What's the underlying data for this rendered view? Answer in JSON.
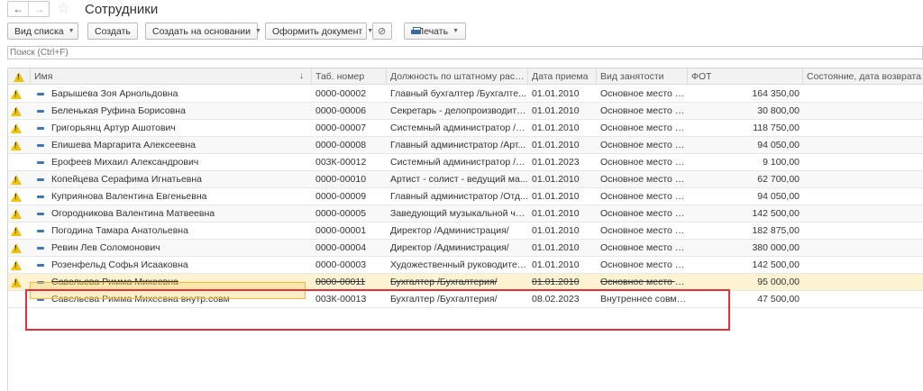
{
  "window": {
    "title": "Сотрудники",
    "back_icon": "←",
    "forward_icon": "→",
    "favorite_icon": "☆"
  },
  "toolbar": {
    "list_view_label": "Вид списка",
    "create_label": "Создать",
    "create_based_label": "Создать на основании",
    "make_document_label": "Оформить документ",
    "attach_icon": "paperclip-icon",
    "print_label": "Печать"
  },
  "search": {
    "placeholder": "Поиск (Ctrl+F)"
  },
  "table": {
    "columns": {
      "warning": "",
      "name": "Имя",
      "tab_num": "Таб. номер",
      "position": "Должность по штатному расп...",
      "hire_date": "Дата приема",
      "employment": "Вид занятости",
      "fot": "ФОТ",
      "status": "Состояние, дата возврата"
    },
    "sort_indicator": "↓",
    "rows": [
      {
        "name": "Барышева Зоя Арнольдовна",
        "tab_num": "0000-00002",
        "position": "Главный бухгалтер /Бухгалте...",
        "hire_date": "01.01.2010",
        "employment": "Основное место р...",
        "fot": "164 350,00"
      },
      {
        "name": "Беленькая Руфина Борисовна",
        "tab_num": "0000-00006",
        "position": "Секретарь - делопроизводите...",
        "hire_date": "01.01.2010",
        "employment": "Основное место р...",
        "fot": "30 800,00"
      },
      {
        "name": "Григорьянц Артур Ашотович",
        "tab_num": "0000-00007",
        "position": "Системный администратор /А...",
        "hire_date": "01.01.2010",
        "employment": "Основное место р...",
        "fot": "118 750,00"
      },
      {
        "name": "Епишева Маргарита Алексеевна",
        "tab_num": "0000-00008",
        "position": "Главный администратор /Арт...",
        "hire_date": "01.01.2010",
        "employment": "Основное место р...",
        "fot": "94 050,00"
      },
      {
        "name": "Ерофеев Михаил Александрович",
        "tab_num": "003К-00012",
        "position": "Системный администратор /А...",
        "hire_date": "01.01.2023",
        "employment": "Основное место р...",
        "fot": "9 100,00"
      },
      {
        "name": "Копейцева Серафима Игнатьевна",
        "tab_num": "0000-00010",
        "position": "Артист - солист - ведущий ма...",
        "hire_date": "01.01.2010",
        "employment": "Основное место р...",
        "fot": "62 700,00"
      },
      {
        "name": "Куприянова Валентина Евгеньевна",
        "tab_num": "0000-00009",
        "position": "Главный администратор /Отд...",
        "hire_date": "01.01.2010",
        "employment": "Основное место р...",
        "fot": "94 050,00"
      },
      {
        "name": "Огородникова Валентина Матвеевна",
        "tab_num": "0000-00005",
        "position": "Заведующий музыкальной ча...",
        "hire_date": "01.01.2010",
        "employment": "Основное место р...",
        "fot": "142 500,00"
      },
      {
        "name": "Погодина Тамара Анатольевна",
        "tab_num": "0000-00001",
        "position": "Директор /Администрация/",
        "hire_date": "01.01.2010",
        "employment": "Основное место р...",
        "fot": "182 875,00"
      },
      {
        "name": "Ревин Лев Соломонович",
        "tab_num": "0000-00004",
        "position": "Директор /Администрация/",
        "hire_date": "01.01.2010",
        "employment": "Основное место р...",
        "fot": "380 000,00"
      },
      {
        "name": "Розенфельд Софья Исааковна",
        "tab_num": "0000-00003",
        "position": "Художественный руководител...",
        "hire_date": "01.01.2010",
        "employment": "Основное место р...",
        "fot": "142 500,00"
      },
      {
        "name": "Савельева Римма Михеевна",
        "tab_num": "0000-00011",
        "position": "Бухгалтер /Бухгалтерия/",
        "hire_date": "01.01.2010",
        "employment": "Основное место р...",
        "fot": "95 000,00"
      },
      {
        "name": "Савельева Римма Михеевна внутр.совм",
        "tab_num": "003К-00013",
        "position": "Бухгалтер /Бухгалтерия/",
        "hire_date": "08.02.2023",
        "employment": "Внутреннее совме...",
        "fot": "47 500,00"
      }
    ]
  },
  "colors": {
    "warning": "#f2c200",
    "row_marker": "#3f77b5",
    "selected_row": "#fdf3d3",
    "highlight_red": "#e5323a",
    "highlight_yellow": "#f3b83c"
  }
}
